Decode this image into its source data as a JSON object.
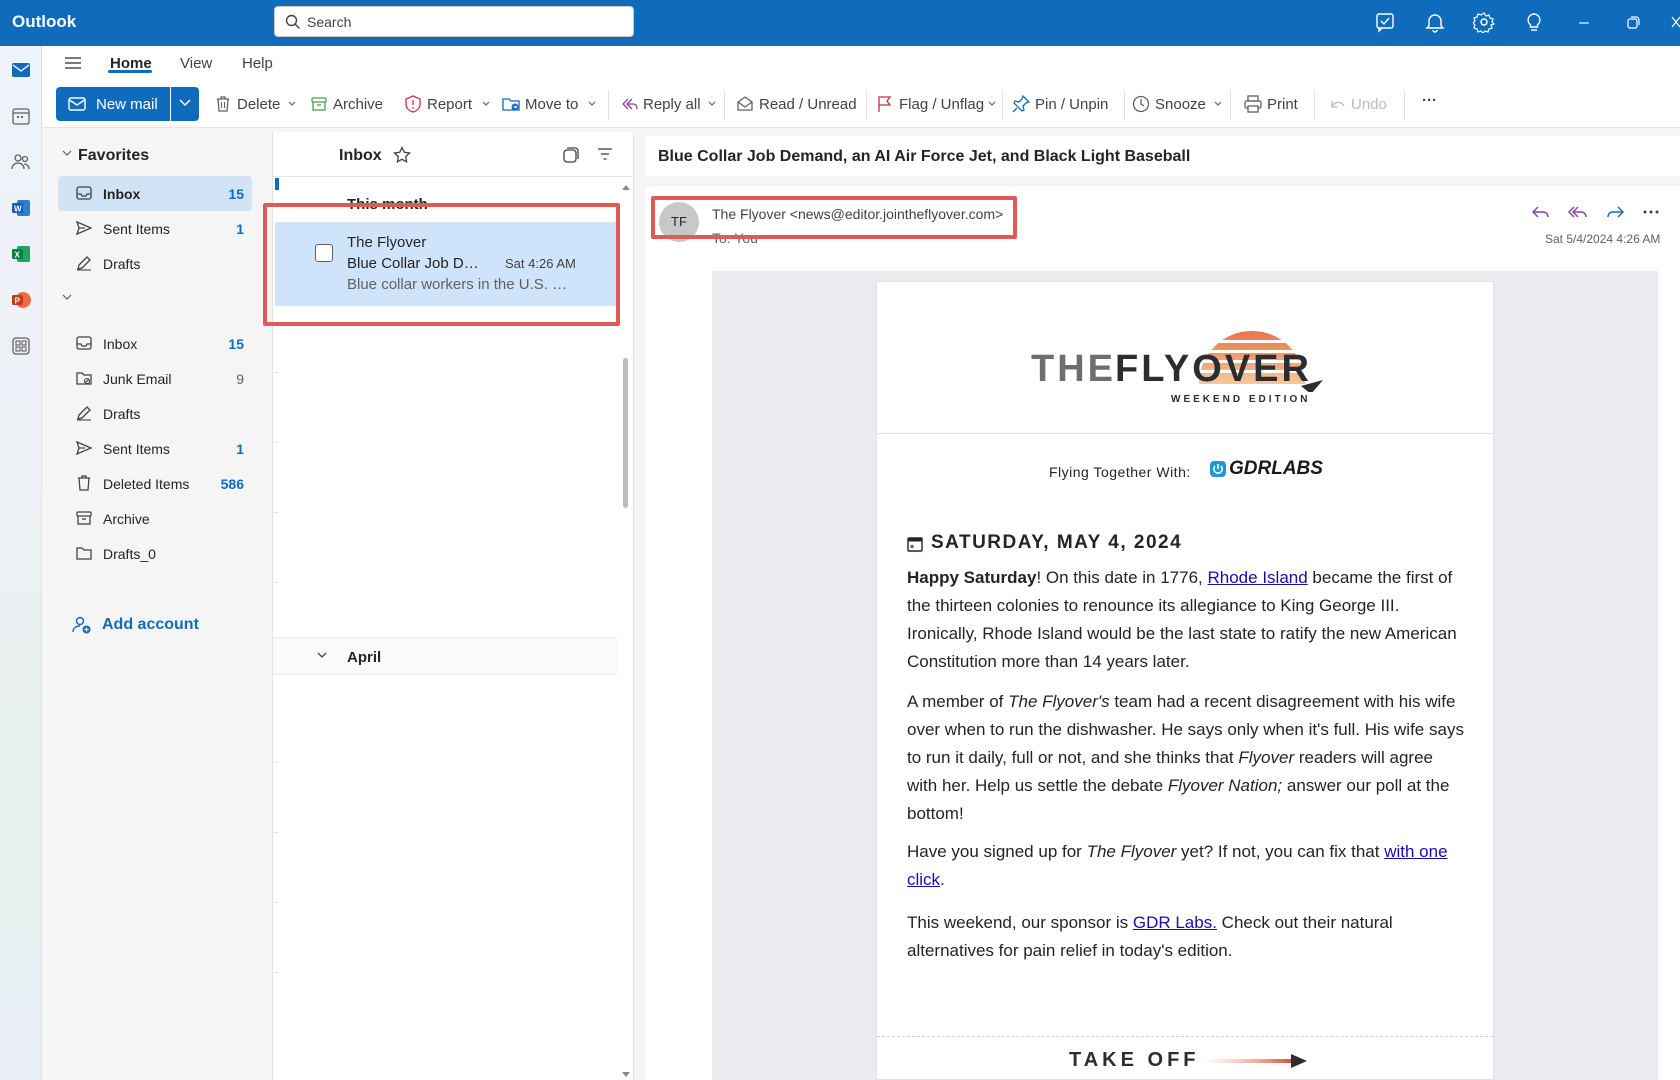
{
  "app": {
    "title": "Outlook"
  },
  "search": {
    "placeholder": "Search"
  },
  "ribbon": {
    "tabs": [
      "Home",
      "View",
      "Help"
    ],
    "new_mail": "New mail",
    "tools": {
      "delete": "Delete",
      "archive": "Archive",
      "report": "Report",
      "move_to": "Move to",
      "reply_all": "Reply all",
      "read_unread": "Read / Unread",
      "flag": "Flag / Unflag",
      "pin": "Pin / Unpin",
      "snooze": "Snooze",
      "print": "Print",
      "undo": "Undo",
      "more": "···"
    }
  },
  "folders": {
    "favorites_label": "Favorites",
    "favorites": [
      {
        "name": "Inbox",
        "count": "15"
      },
      {
        "name": "Sent Items",
        "count": "1"
      },
      {
        "name": "Drafts",
        "count": ""
      }
    ],
    "account": [
      {
        "name": "Inbox",
        "count": "15"
      },
      {
        "name": "Junk Email",
        "count": "9"
      },
      {
        "name": "Drafts",
        "count": ""
      },
      {
        "name": "Sent Items",
        "count": "1"
      },
      {
        "name": "Deleted Items",
        "count": "586"
      },
      {
        "name": "Archive",
        "count": ""
      },
      {
        "name": "Drafts_0",
        "count": ""
      }
    ],
    "add_account": "Add account"
  },
  "message_list": {
    "title": "Inbox",
    "group_this_month": "This month",
    "group_april": "April",
    "items": [
      {
        "sender": "The Flyover",
        "subject": "Blue Collar Job Demand, an AI Air Force Jet, and Black Light Baseball",
        "time": "Sat 4:26 AM",
        "preview": "Blue collar workers in the U.S. labor market..."
      }
    ]
  },
  "reading": {
    "subject": "Blue Collar Job Demand, an AI Air Force Jet, and Black Light Baseball",
    "avatar_initials": "TF",
    "from": "The Flyover <news@editor.jointheflyover.com>",
    "to": "To:  You",
    "date": "Sat 5/4/2024 4:26 AM"
  },
  "newsletter": {
    "logo_the": "THE",
    "logo_flyover": "FLYOVER",
    "logo_sub": "WEEKEND EDITION",
    "sponsor_label": "Flying Together With:",
    "sponsor_name": "GDRLABS",
    "date_heading": "SATURDAY, MAY 4, 2024",
    "p1_bold": "Happy Saturday",
    "p1_a": "! On this date in 1776, ",
    "p1_link": "Rhode Island",
    "p1_b": " became the first of the thirteen colonies to renounce its allegiance to King George III. Ironically, Rhode Island would be the last state to ratify the new American Constitution more than 14 years later.",
    "p2_a": "A member of ",
    "p2_i1": "The Flyover's",
    "p2_b": " team had a recent disagreement with his wife over when to run the dishwasher. He says only when it's full. His wife says to run it daily, full or not, and she thinks that  ",
    "p2_i2": "Flyover",
    "p2_c": " readers will agree with her. Help us settle the debate ",
    "p2_i3": "Flyover Nation;",
    "p2_d": " answer our poll at the bottom!",
    "p3_a": "Have you signed up for ",
    "p3_i": "The Flyover",
    "p3_b": " yet? If not, you can fix that ",
    "p3_link": "with one click",
    "p3_c": ".",
    "p4_a": "This weekend, our sponsor is ",
    "p4_link": "GDR Labs.",
    "p4_b": " Check out their natural alternatives for pain relief in today's edition.",
    "takeoff": "TAKE OFF"
  },
  "colors": {
    "accent": "#0f6cbd",
    "selected": "#cfe4fa",
    "highlight": "#e05a5a"
  }
}
